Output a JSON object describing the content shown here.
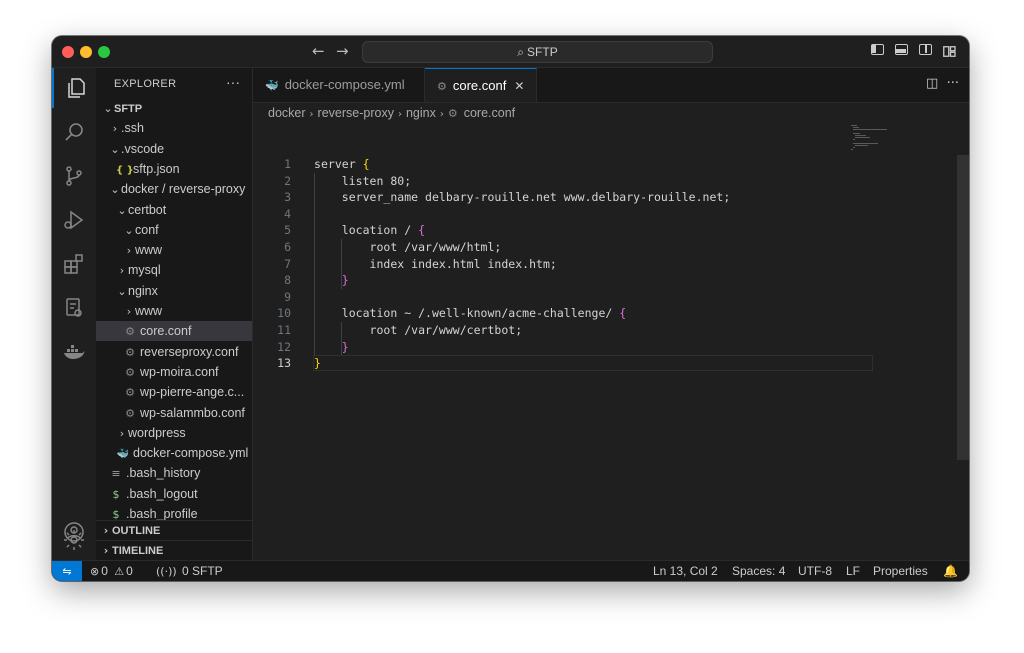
{
  "titlebar": {
    "search_label": "SFTP"
  },
  "activity": {
    "items": [
      "explorer-icon",
      "search-icon",
      "source-control-icon",
      "run-debug-icon",
      "extensions-icon",
      "remote-explorer-icon",
      "docker-icon"
    ],
    "bottom": [
      "account-icon",
      "settings-gear-icon"
    ]
  },
  "sidebar": {
    "title": "EXPLORER",
    "more": "···",
    "tree": [
      {
        "label": "SFTP",
        "indent": 0,
        "chev": "open",
        "icon": "",
        "root": true
      },
      {
        "label": ".ssh",
        "indent": 1,
        "chev": "closed",
        "icon": ""
      },
      {
        "label": ".vscode",
        "indent": 1,
        "chev": "open",
        "icon": ""
      },
      {
        "label": "sftp.json",
        "indent": 2,
        "chev": "",
        "icon": "json"
      },
      {
        "label": "docker / reverse-proxy",
        "indent": 1,
        "chev": "open",
        "icon": ""
      },
      {
        "label": "certbot",
        "indent": 2,
        "chev": "open",
        "icon": ""
      },
      {
        "label": "conf",
        "indent": 3,
        "chev": "open",
        "icon": ""
      },
      {
        "label": "www",
        "indent": 3,
        "chev": "closed",
        "icon": ""
      },
      {
        "label": "mysql",
        "indent": 2,
        "chev": "closed",
        "icon": ""
      },
      {
        "label": "nginx",
        "indent": 2,
        "chev": "open",
        "icon": ""
      },
      {
        "label": "www",
        "indent": 3,
        "chev": "closed",
        "icon": ""
      },
      {
        "label": "core.conf",
        "indent": 3,
        "chev": "",
        "icon": "gear",
        "selected": true
      },
      {
        "label": "reverseproxy.conf",
        "indent": 3,
        "chev": "",
        "icon": "gear"
      },
      {
        "label": "wp-moira.conf",
        "indent": 3,
        "chev": "",
        "icon": "gear"
      },
      {
        "label": "wp-pierre-ange.c...",
        "indent": 3,
        "chev": "",
        "icon": "gear"
      },
      {
        "label": "wp-salammbo.conf",
        "indent": 3,
        "chev": "",
        "icon": "gear"
      },
      {
        "label": "wordpress",
        "indent": 2,
        "chev": "closed",
        "icon": ""
      },
      {
        "label": "docker-compose.yml",
        "indent": 2,
        "chev": "",
        "icon": "whale"
      },
      {
        "label": ".bash_history",
        "indent": 1,
        "chev": "",
        "icon": "lines"
      },
      {
        "label": ".bash_logout",
        "indent": 1,
        "chev": "",
        "icon": "dollar"
      },
      {
        "label": ".bash_profile",
        "indent": 1,
        "chev": "",
        "icon": "dollar"
      }
    ],
    "outline": "OUTLINE",
    "timeline": "TIMELINE"
  },
  "tabs": [
    {
      "label": "docker-compose.yml",
      "icon": "whale",
      "active": false
    },
    {
      "label": "core.conf",
      "icon": "gear",
      "active": true
    }
  ],
  "breadcrumb": [
    "docker",
    "reverse-proxy",
    "nginx",
    "core.conf"
  ],
  "editor": {
    "current_line": 13,
    "lines": [
      "server {",
      "    listen 80;",
      "    server_name delbary-rouille.net www.delbary-rouille.net;",
      "",
      "    location / {",
      "        root /var/www/html;",
      "        index index.html index.htm;",
      "    }",
      "",
      "    location ~ /.well-known/acme-challenge/ {",
      "        root /var/www/certbot;",
      "    }",
      "}"
    ]
  },
  "status": {
    "errors": "0",
    "warnings": "0",
    "ports": "0",
    "sftp": "SFTP",
    "position": "Ln 13, Col 2",
    "spaces": "Spaces: 4",
    "encoding": "UTF-8",
    "eol": "LF",
    "properties": "Properties"
  },
  "colors": {
    "accent": "#0078d4",
    "brace_outer": "#ffd700",
    "brace_inner": "#da70d6"
  }
}
